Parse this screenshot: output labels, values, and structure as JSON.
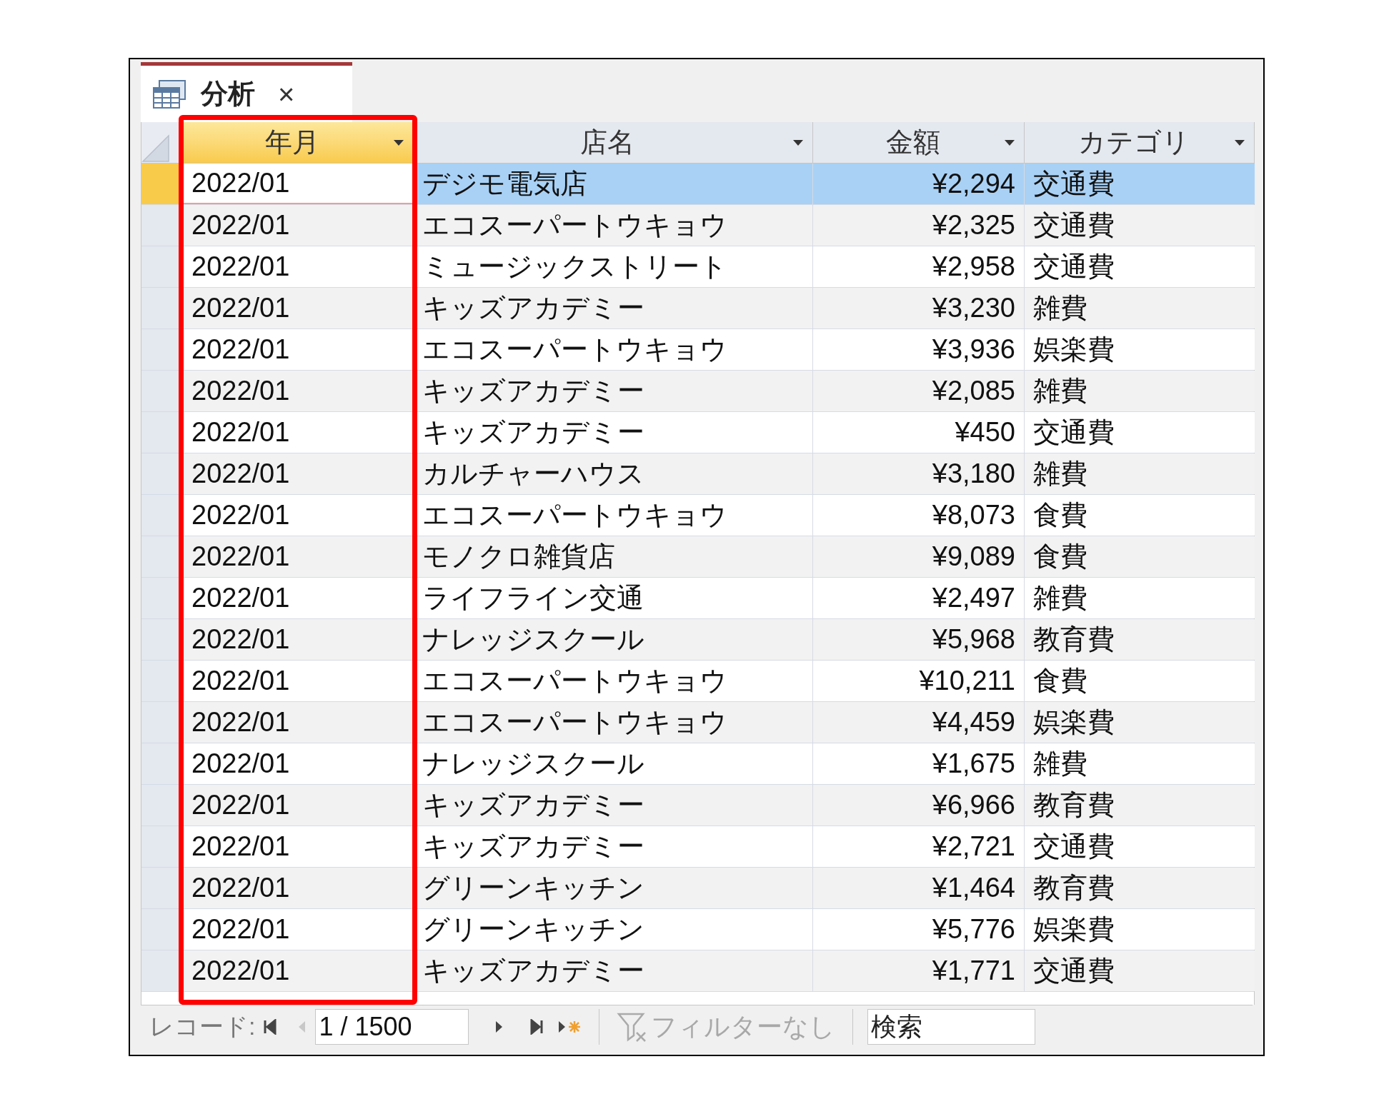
{
  "tab": {
    "title": "分析",
    "close": "×"
  },
  "columns": [
    {
      "label": "年月",
      "selected": true
    },
    {
      "label": "店名",
      "selected": false
    },
    {
      "label": "金額",
      "selected": false
    },
    {
      "label": "カテゴリ",
      "selected": false
    }
  ],
  "rows": [
    {
      "month": "2022/01",
      "shop": "デジモ電気店",
      "amount": "¥2,294",
      "category": "交通費",
      "selected": true
    },
    {
      "month": "2022/01",
      "shop": "エコスーパートウキョウ",
      "amount": "¥2,325",
      "category": "交通費",
      "selected": false
    },
    {
      "month": "2022/01",
      "shop": "ミュージックストリート",
      "amount": "¥2,958",
      "category": "交通費",
      "selected": false
    },
    {
      "month": "2022/01",
      "shop": "キッズアカデミー",
      "amount": "¥3,230",
      "category": "雑費",
      "selected": false
    },
    {
      "month": "2022/01",
      "shop": "エコスーパートウキョウ",
      "amount": "¥3,936",
      "category": "娯楽費",
      "selected": false
    },
    {
      "month": "2022/01",
      "shop": "キッズアカデミー",
      "amount": "¥2,085",
      "category": "雑費",
      "selected": false
    },
    {
      "month": "2022/01",
      "shop": "キッズアカデミー",
      "amount": "¥450",
      "category": "交通費",
      "selected": false
    },
    {
      "month": "2022/01",
      "shop": "カルチャーハウス",
      "amount": "¥3,180",
      "category": "雑費",
      "selected": false
    },
    {
      "month": "2022/01",
      "shop": "エコスーパートウキョウ",
      "amount": "¥8,073",
      "category": "食費",
      "selected": false
    },
    {
      "month": "2022/01",
      "shop": "モノクロ雑貨店",
      "amount": "¥9,089",
      "category": "食費",
      "selected": false
    },
    {
      "month": "2022/01",
      "shop": "ライフライン交通",
      "amount": "¥2,497",
      "category": "雑費",
      "selected": false
    },
    {
      "month": "2022/01",
      "shop": "ナレッジスクール",
      "amount": "¥5,968",
      "category": "教育費",
      "selected": false
    },
    {
      "month": "2022/01",
      "shop": "エコスーパートウキョウ",
      "amount": "¥10,211",
      "category": "食費",
      "selected": false
    },
    {
      "month": "2022/01",
      "shop": "エコスーパートウキョウ",
      "amount": "¥4,459",
      "category": "娯楽費",
      "selected": false
    },
    {
      "month": "2022/01",
      "shop": "ナレッジスクール",
      "amount": "¥1,675",
      "category": "雑費",
      "selected": false
    },
    {
      "month": "2022/01",
      "shop": "キッズアカデミー",
      "amount": "¥6,966",
      "category": "教育費",
      "selected": false
    },
    {
      "month": "2022/01",
      "shop": "キッズアカデミー",
      "amount": "¥2,721",
      "category": "交通費",
      "selected": false
    },
    {
      "month": "2022/01",
      "shop": "グリーンキッチン",
      "amount": "¥1,464",
      "category": "教育費",
      "selected": false
    },
    {
      "month": "2022/01",
      "shop": "グリーンキッチン",
      "amount": "¥5,776",
      "category": "娯楽費",
      "selected": false
    },
    {
      "month": "2022/01",
      "shop": "キッズアカデミー",
      "amount": "¥1,771",
      "category": "交通費",
      "selected": false
    }
  ],
  "navigation": {
    "label": "レコード:",
    "position": "1 / 1500",
    "filter": "フィルターなし",
    "filter_disabled": true,
    "search": {
      "placeholder": "検索"
    }
  }
}
